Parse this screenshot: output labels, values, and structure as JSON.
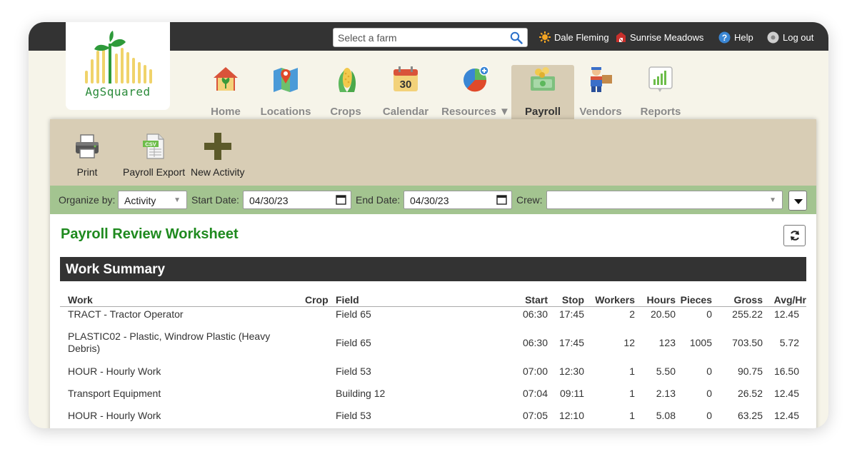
{
  "header": {
    "search_placeholder": "Select a farm",
    "user_name": "Dale Fleming",
    "farm_name": "Sunrise Meadows",
    "help_label": "Help",
    "logout_label": "Log out"
  },
  "logo": {
    "text": "AgSquared"
  },
  "nav": {
    "items": [
      {
        "label": "Home",
        "icon": "home-icon"
      },
      {
        "label": "Locations",
        "icon": "map-icon"
      },
      {
        "label": "Crops",
        "icon": "corn-icon"
      },
      {
        "label": "Calendar",
        "icon": "calendar-icon",
        "day": "30"
      },
      {
        "label": "Resources ▼",
        "icon": "pie-chart-icon"
      },
      {
        "label": "Payroll",
        "icon": "money-icon",
        "active": true
      },
      {
        "label": "Vendors",
        "icon": "worker-icon"
      },
      {
        "label": "Reports",
        "icon": "report-icon"
      }
    ]
  },
  "toolbar": {
    "print_label": "Print",
    "export_label": "Payroll Export",
    "export_badge": "CSV",
    "new_label": "New Activity"
  },
  "filters": {
    "organize_label": "Organize by:",
    "organize_value": "Activity",
    "start_label": "Start Date:",
    "start_value": "04/30/23",
    "end_label": "End Date:",
    "end_value": "04/30/23",
    "crew_label": "Crew:",
    "crew_value": ""
  },
  "worksheet": {
    "title": "Payroll Review Worksheet",
    "section_title": "Work Summary",
    "columns": {
      "work": "Work",
      "crop": "Crop",
      "field": "Field",
      "start": "Start",
      "stop": "Stop",
      "workers": "Workers",
      "hours": "Hours",
      "pieces": "Pieces",
      "gross": "Gross",
      "avg": "Avg/Hr"
    },
    "rows": [
      {
        "work": "TRACT - Tractor Operator",
        "crop": "",
        "field": "Field 65",
        "start": "06:30",
        "stop": "17:45",
        "workers": "2",
        "hours": "20.50",
        "pieces": "0",
        "gross": "255.22",
        "avg": "12.45"
      },
      {
        "work": "PLASTIC02 - Plastic, Windrow Plastic (Heavy Debris)",
        "crop": "",
        "field": "Field 65",
        "start": "06:30",
        "stop": "17:45",
        "workers": "12",
        "hours": "123",
        "pieces": "1005",
        "gross": "703.50",
        "avg": "5.72"
      },
      {
        "work": "HOUR - Hourly Work",
        "crop": "",
        "field": "Field 53",
        "start": "07:00",
        "stop": "12:30",
        "workers": "1",
        "hours": "5.50",
        "pieces": "0",
        "gross": "90.75",
        "avg": "16.50"
      },
      {
        "work": "Transport Equipment",
        "crop": "",
        "field": "Building 12",
        "start": "07:04",
        "stop": "09:11",
        "workers": "1",
        "hours": "2.13",
        "pieces": "0",
        "gross": "26.52",
        "avg": "12.45"
      },
      {
        "work": "HOUR - Hourly Work",
        "crop": "",
        "field": "Field 53",
        "start": "07:05",
        "stop": "12:10",
        "workers": "1",
        "hours": "5.08",
        "pieces": "0",
        "gross": "63.25",
        "avg": "12.45"
      }
    ]
  },
  "colors": {
    "topbar": "#333333",
    "accent_green": "#1f8a1f",
    "toolbar_tan": "#d8cdb5",
    "filter_green": "#a3c490",
    "page_cream": "#f6f4e9"
  }
}
